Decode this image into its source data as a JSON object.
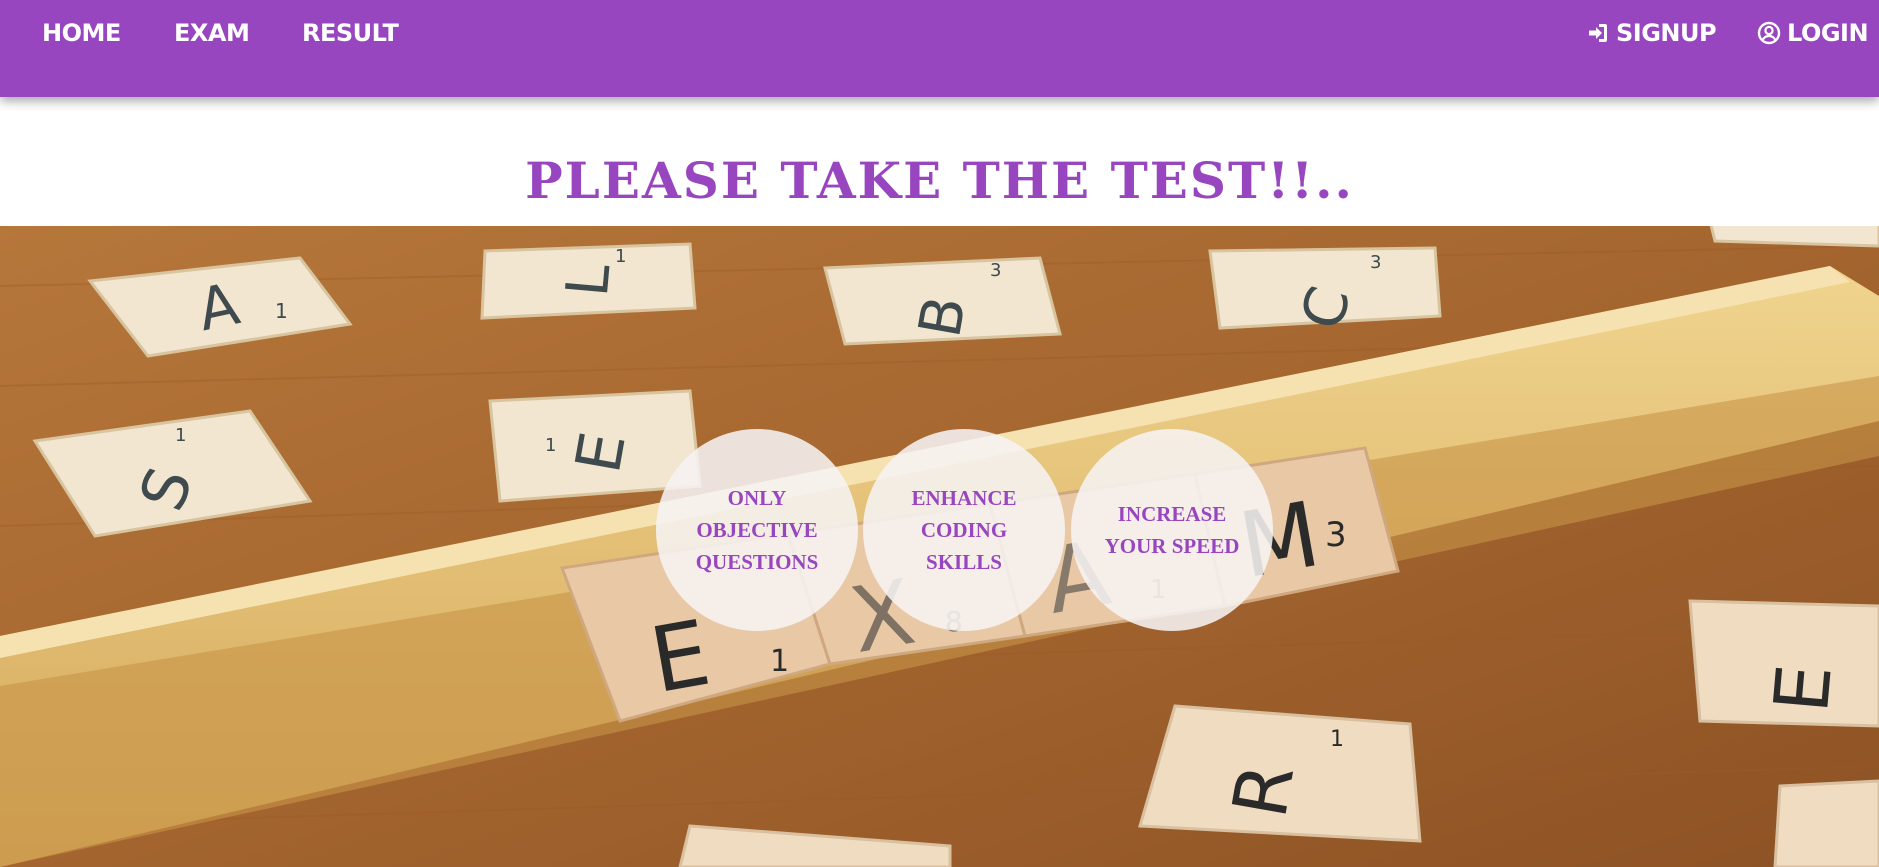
{
  "navbar": {
    "home_label": "HOME",
    "exam_label": "EXAM",
    "result_label": "RESULT",
    "signup_label": "SIGNUP",
    "login_label": "LOGIN",
    "background_color": "#9846bf"
  },
  "heading": {
    "text": "PLEASE TAKE THE TEST!!.."
  },
  "features": [
    {
      "text": "ONLY OBJECTIVE QUESTIONS"
    },
    {
      "text": "ENHANCE CODING SKILLS"
    },
    {
      "text": "INCREASE YOUR SPEED"
    }
  ],
  "tiles": {
    "a": "A",
    "a_sub": "1",
    "l": "L",
    "l_sub": "1",
    "b": "B",
    "b_sub": "3",
    "c": "C",
    "c_sub": "3",
    "s": "S",
    "s_sub": "1",
    "e_top": "E",
    "e_top_sub": "1",
    "e": "E",
    "e_sub": "1",
    "x": "X",
    "x_sub": "8",
    "a2": "A",
    "a2_sub": "1",
    "m": "M",
    "m_sub": "3",
    "r": "R",
    "r_sub": "1",
    "e_right": "E"
  },
  "colors": {
    "accent": "#9846bf",
    "circle_bg": "#f6f2f2"
  },
  "icons": {
    "signup": "sign-in-icon",
    "login": "user-circle-icon"
  }
}
